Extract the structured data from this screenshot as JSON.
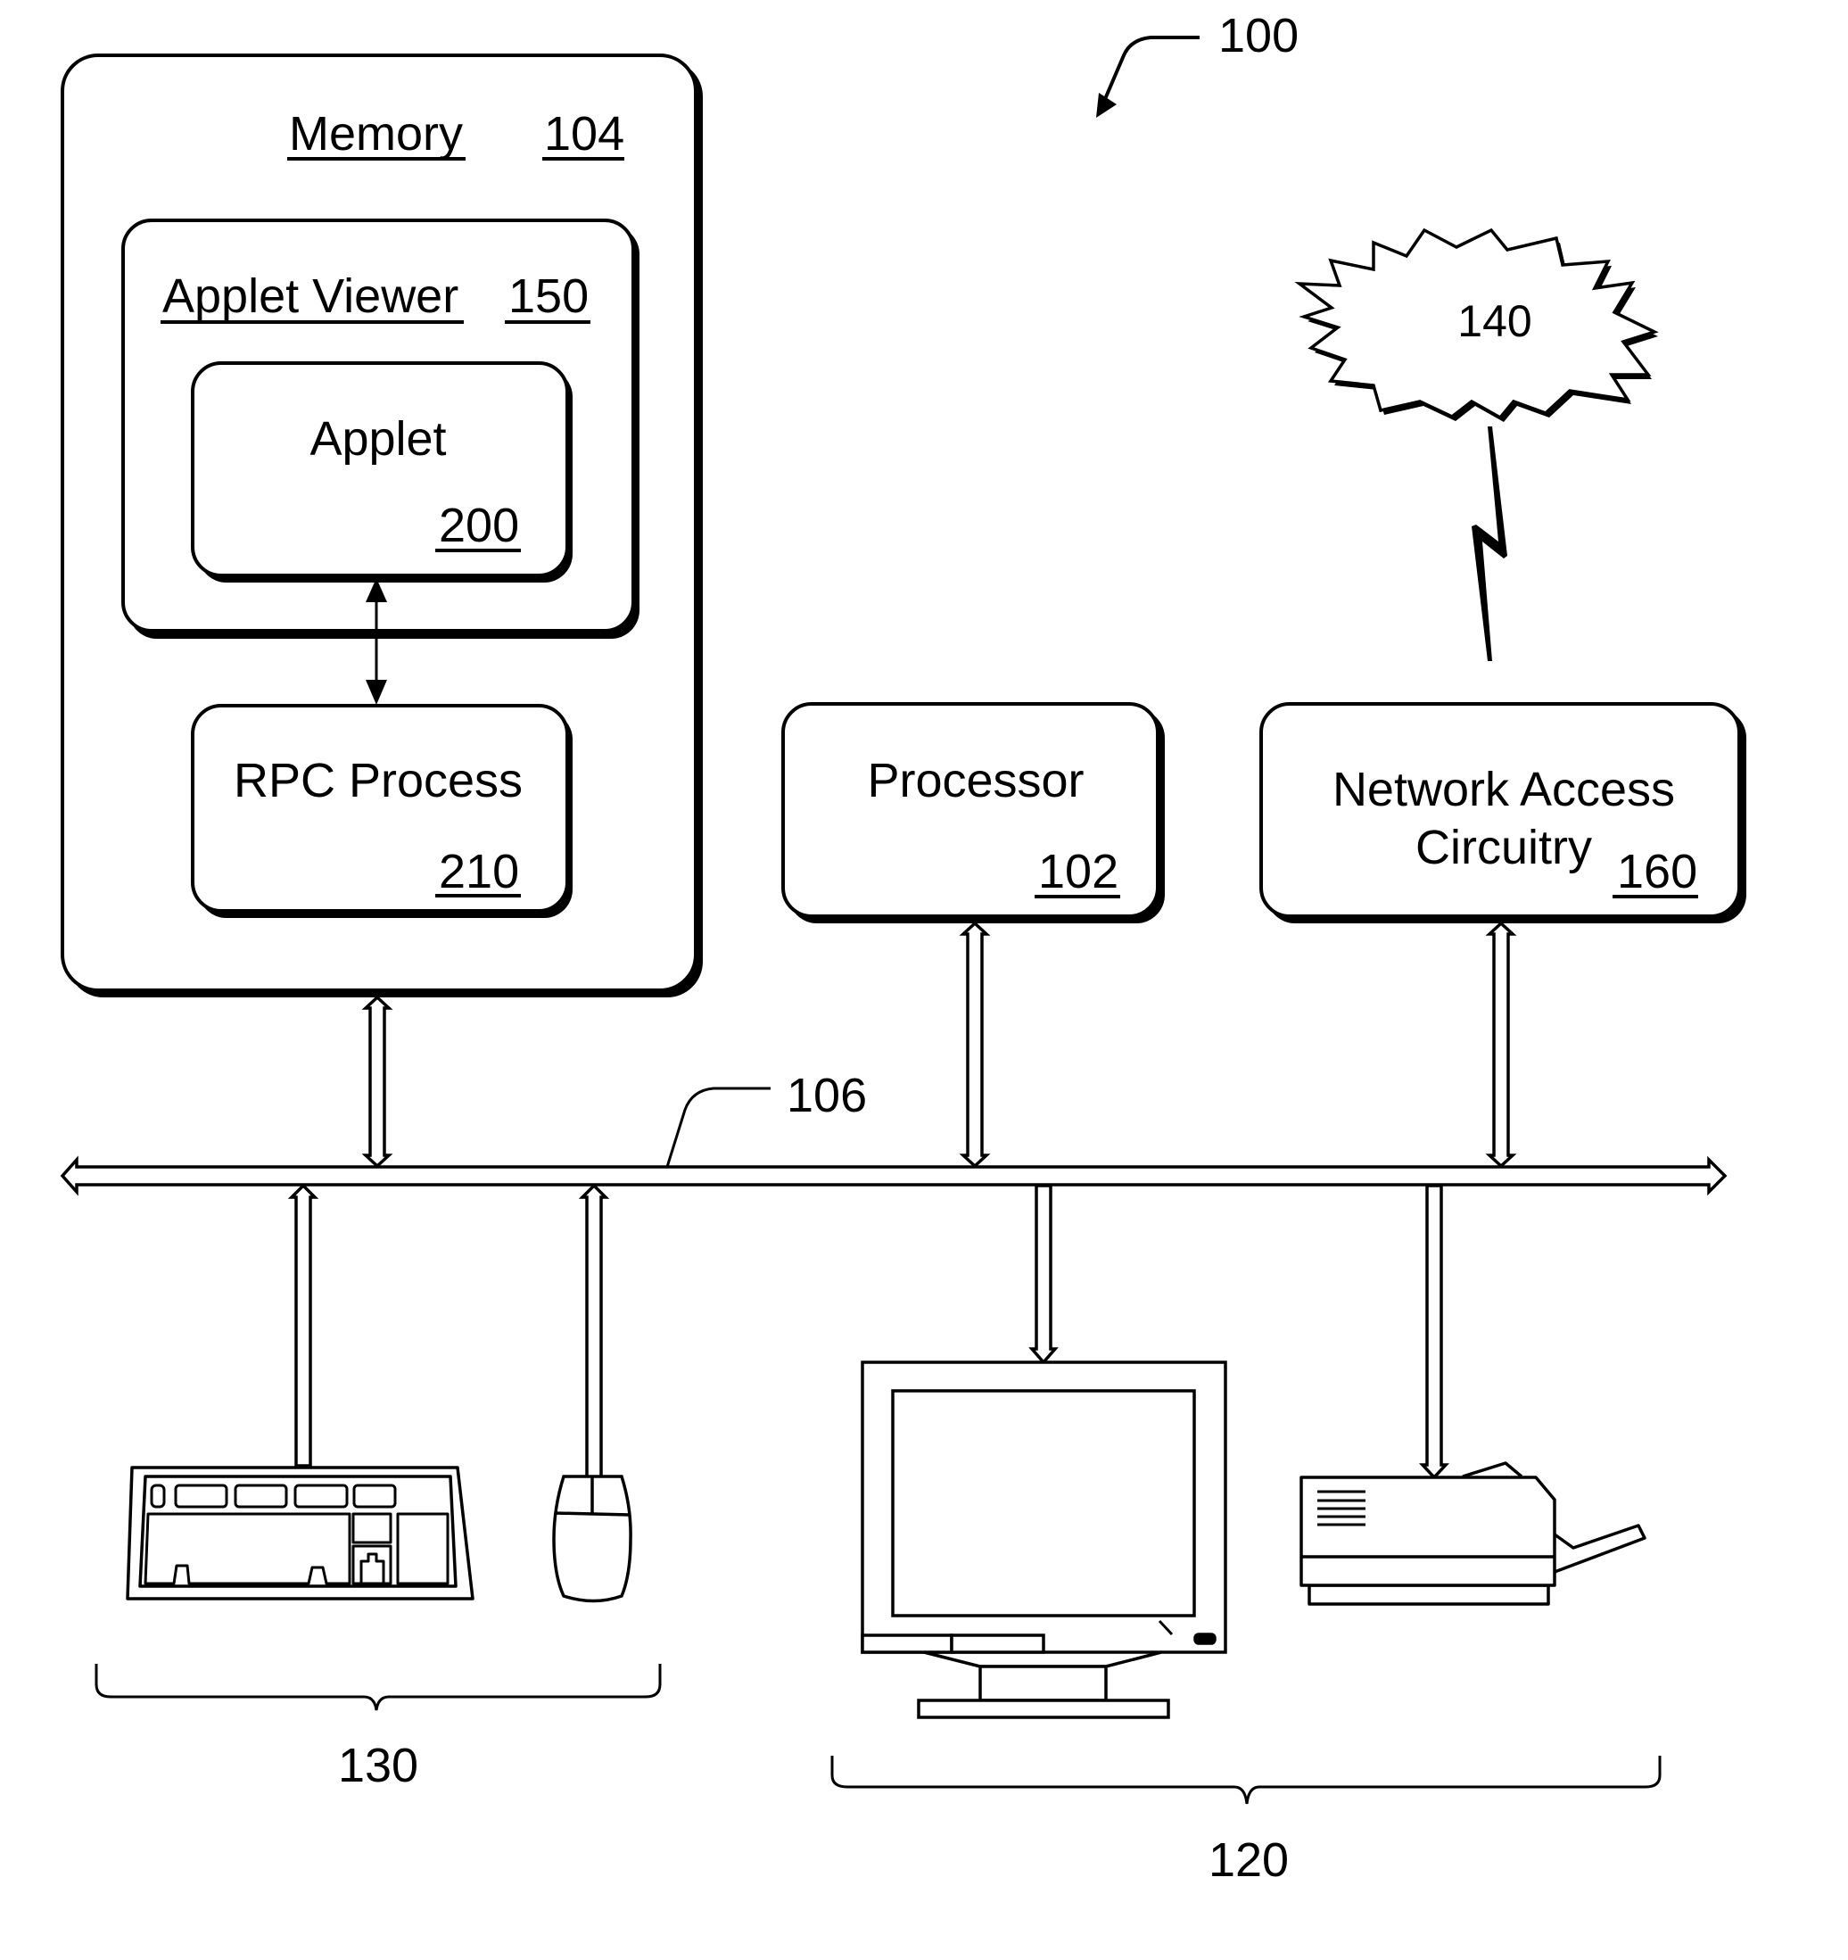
{
  "figure": {
    "ref": "100",
    "bus_ref": "106",
    "network_ref": "140",
    "input_devices_ref": "130",
    "output_devices_ref": "120"
  },
  "memory": {
    "label": "Memory",
    "ref": "104"
  },
  "applet_viewer": {
    "label": "Applet Viewer",
    "ref": "150"
  },
  "applet": {
    "label": "Applet",
    "ref": "200"
  },
  "rpc_process": {
    "label": "RPC Process",
    "ref": "210"
  },
  "processor": {
    "label": "Processor",
    "ref": "102"
  },
  "network_access": {
    "label_line1": "Network Access",
    "label_line2": "Circuitry",
    "ref": "160"
  },
  "devices": {
    "input": [
      "keyboard",
      "mouse"
    ],
    "output": [
      "monitor",
      "printer"
    ]
  },
  "colors": {
    "ink": "#000000",
    "paper": "#ffffff"
  }
}
